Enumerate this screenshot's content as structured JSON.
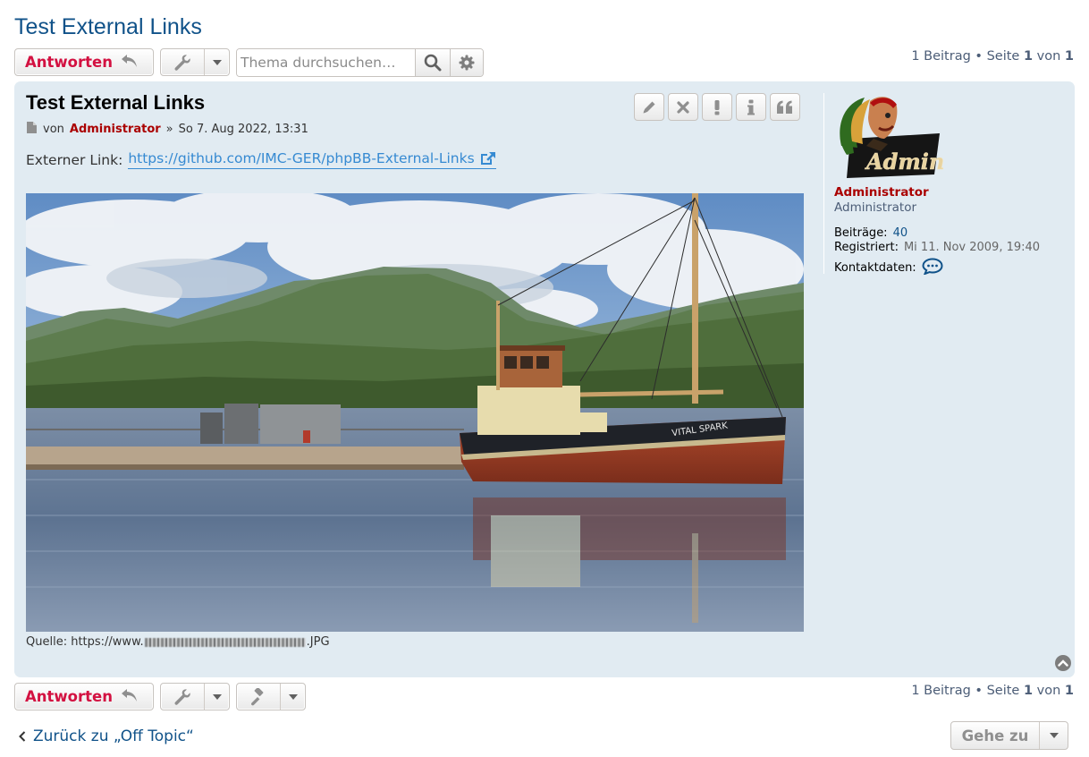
{
  "topic": {
    "title": "Test External Links"
  },
  "toolbar": {
    "reply_label": "Antworten",
    "search_placeholder": "Thema durchsuchen…"
  },
  "pagination": {
    "count": "1 Beitrag",
    "separator": "•",
    "page_label": "Seite",
    "current_page": "1",
    "of_label": "von",
    "total_pages": "1"
  },
  "post": {
    "title": "Test External Links",
    "by_label": "von",
    "author": "Administrator",
    "date_prefix": "»",
    "date": "So 7. Aug 2022, 13:31",
    "ext_link_label": "Externer Link:",
    "ext_link_url": "https://github.com/IMC-GER/phpBB-External-Links",
    "source_label": "Quelle: https://www.",
    "source_suffix": ".JPG",
    "buttons": [
      "edit",
      "delete",
      "report",
      "info",
      "quote"
    ]
  },
  "profile": {
    "name": "Administrator",
    "rank": "Administrator",
    "avatar_text": "Admin",
    "posts_label": "Beiträge:",
    "posts_value": "40",
    "registered_label": "Registriert:",
    "registered_value": "Mi 11. Nov 2009, 19:40",
    "contact_label": "Kontaktdaten:"
  },
  "footer": {
    "back_label": "Zurück zu „Off Topic“",
    "goto_label": "Gehe zu"
  },
  "photo": {
    "boat_name": "VITAL SPARK"
  },
  "colors": {
    "brand": "#105289",
    "reply": "#d31141",
    "post_bg": "#e1ebf2",
    "admin": "#aa0000",
    "link": "#368ad2"
  }
}
